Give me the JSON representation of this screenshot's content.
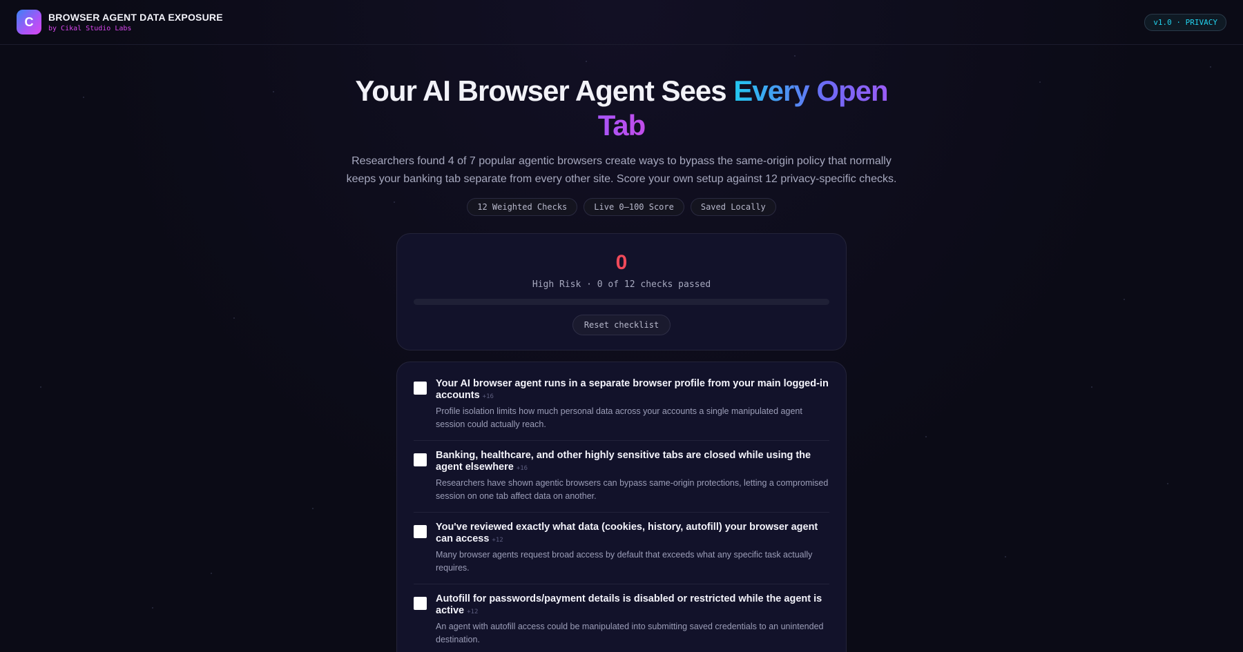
{
  "header": {
    "logo_letter": "C",
    "app_title": "BROWSER AGENT DATA EXPOSURE",
    "app_subtitle": "by Cikal Studio Labs",
    "version_badge": "v1.0 · PRIVACY"
  },
  "hero": {
    "title_part1": "Your AI Browser Agent Sees ",
    "title_highlight1": "Every Open",
    "title_highlight2": "Tab",
    "description": "Researchers found 4 of 7 popular agentic browsers create ways to bypass the same-origin policy that normally keeps your banking tab separate from every other site. Score your own setup against 12 privacy-specific checks.",
    "chips": [
      "12 Weighted Checks",
      "Live 0–100 Score",
      "Saved Locally"
    ]
  },
  "score": {
    "value": "0",
    "status": "High Risk · 0 of 12 checks passed",
    "progress_percent": 0,
    "reset_label": "Reset checklist"
  },
  "checklist": [
    {
      "title": "Your AI browser agent runs in a separate browser profile from your main logged-in accounts",
      "weight": "+16",
      "description": "Profile isolation limits how much personal data across your accounts a single manipulated agent session could actually reach.",
      "checked": false
    },
    {
      "title": "Banking, healthcare, and other highly sensitive tabs are closed while using the agent elsewhere",
      "weight": "+16",
      "description": "Researchers have shown agentic browsers can bypass same-origin protections, letting a compromised session on one tab affect data on another.",
      "checked": false
    },
    {
      "title": "You've reviewed exactly what data (cookies, history, autofill) your browser agent can access",
      "weight": "+12",
      "description": "Many browser agents request broad access by default that exceeds what any specific task actually requires.",
      "checked": false
    },
    {
      "title": "Autofill for passwords/payment details is disabled or restricted while the agent is active",
      "weight": "+12",
      "description": "An agent with autofill access could be manipulated into submitting saved credentials to an unintended destination.",
      "checked": false
    }
  ]
}
